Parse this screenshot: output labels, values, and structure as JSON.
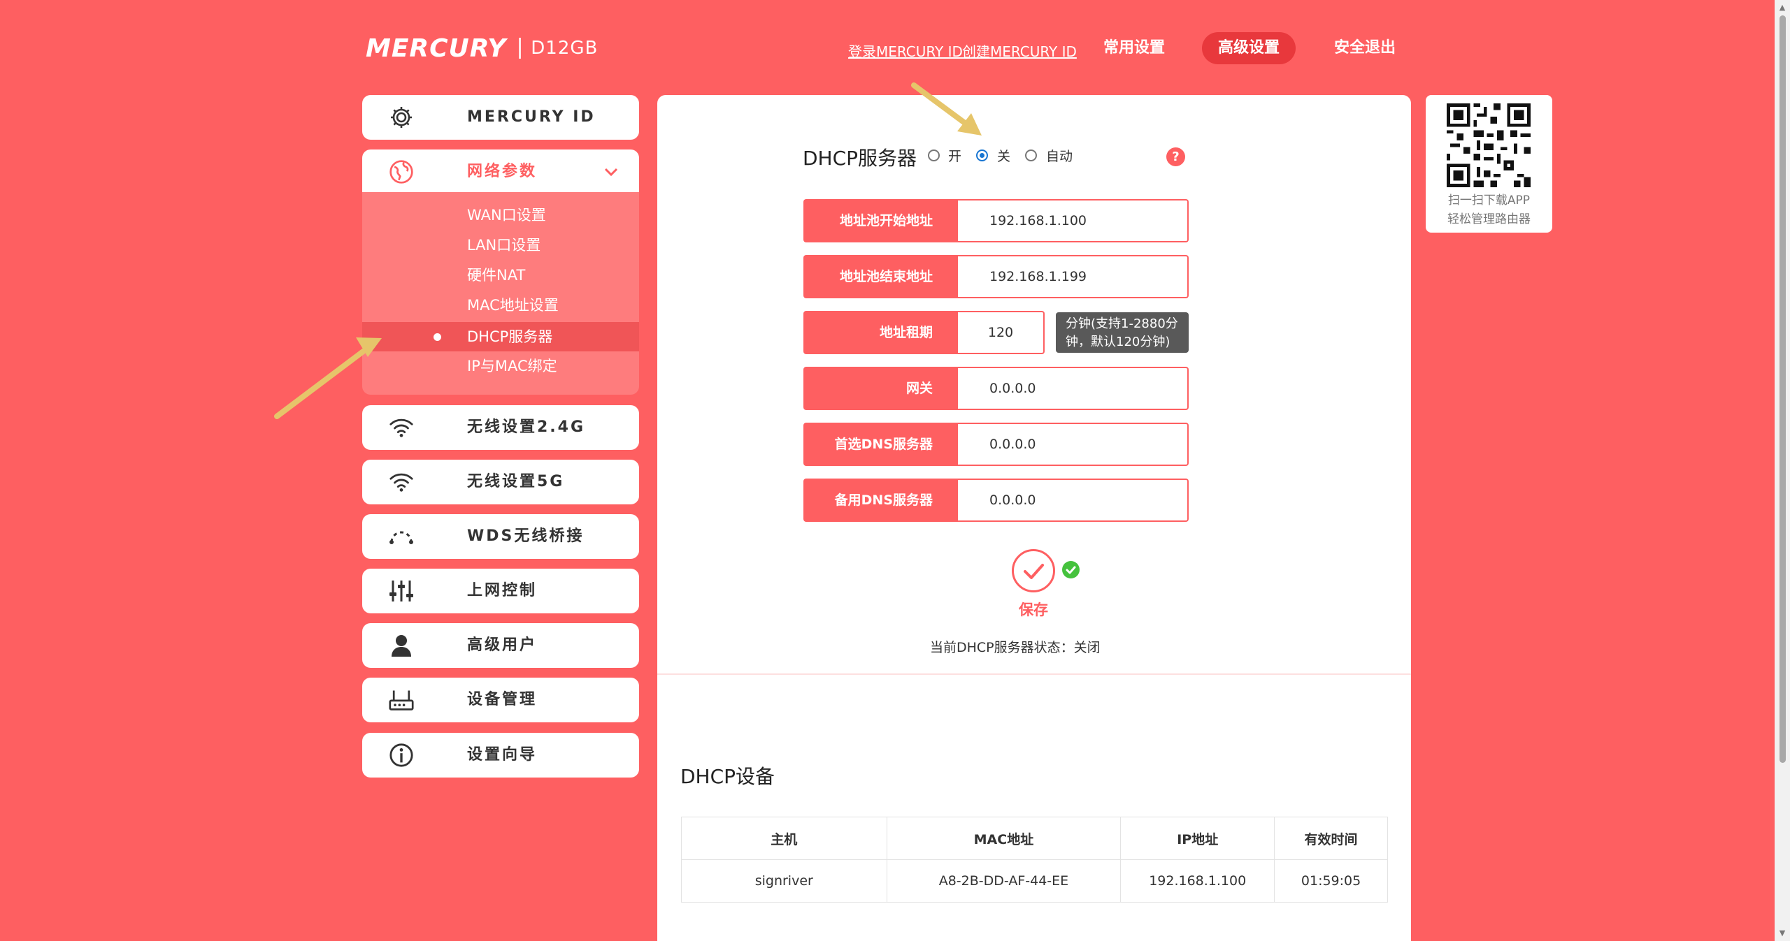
{
  "header": {
    "brand": "MERCURY",
    "model": "D12GB",
    "links": [
      "登录MERCURY ID",
      "创建MERCURY ID"
    ],
    "nav": [
      {
        "label": "常用设置",
        "active": false
      },
      {
        "label": "高级设置",
        "active": true
      },
      {
        "label": "安全退出",
        "active": false
      }
    ]
  },
  "sidebar": {
    "items": [
      {
        "label": "MERCURY ID",
        "icon": "gear-icon"
      },
      {
        "label": "网络参数",
        "icon": "globe-icon",
        "expanded": true
      },
      {
        "label": "无线设置2.4G",
        "icon": "wifi-icon"
      },
      {
        "label": "无线设置5G",
        "icon": "wifi-icon"
      },
      {
        "label": "WDS无线桥接",
        "icon": "bridge-icon"
      },
      {
        "label": "上网控制",
        "icon": "sliders-icon"
      },
      {
        "label": "高级用户",
        "icon": "user-icon"
      },
      {
        "label": "设备管理",
        "icon": "router-icon"
      },
      {
        "label": "设置向导",
        "icon": "info-icon"
      }
    ],
    "submenu": [
      "WAN口设置",
      "LAN口设置",
      "硬件NAT",
      "MAC地址设置",
      "DHCP服务器",
      "IP与MAC绑定"
    ],
    "active_submenu": "DHCP服务器"
  },
  "dhcp": {
    "title": "DHCP服务器",
    "options": [
      "开",
      "关",
      "自动"
    ],
    "selected": "关",
    "help": "?",
    "fields": [
      {
        "label": "地址池开始地址",
        "value": "192.168.1.100"
      },
      {
        "label": "地址池结束地址",
        "value": "192.168.1.199"
      },
      {
        "label": "地址租期",
        "value": "120"
      },
      {
        "label": "网关",
        "value": "0.0.0.0"
      },
      {
        "label": "首选DNS服务器",
        "value": "0.0.0.0"
      },
      {
        "label": "备用DNS服务器",
        "value": "0.0.0.0"
      }
    ],
    "lease_tip_line1": "分钟(支持1-2880分",
    "lease_tip_line2": "钟，默认120分钟)",
    "save_label": "保存",
    "status": "当前DHCP服务器状态：关闭"
  },
  "devices": {
    "title": "DHCP设备",
    "columns": [
      "主机",
      "MAC地址",
      "IP地址",
      "有效时间"
    ],
    "rows": [
      [
        "signriver",
        "A8-2B-DD-AF-44-EE",
        "192.168.1.100",
        "01:59:05"
      ]
    ]
  },
  "qr": {
    "line1": "扫一扫下载APP",
    "line2": "轻松管理路由器"
  },
  "colors": {
    "accent": "#fe5f61",
    "nav_active": "#e8383c",
    "submenu_bg": "#fe7c7d",
    "ok": "#45c23d",
    "annotation_arrow": "#e6c56a"
  }
}
